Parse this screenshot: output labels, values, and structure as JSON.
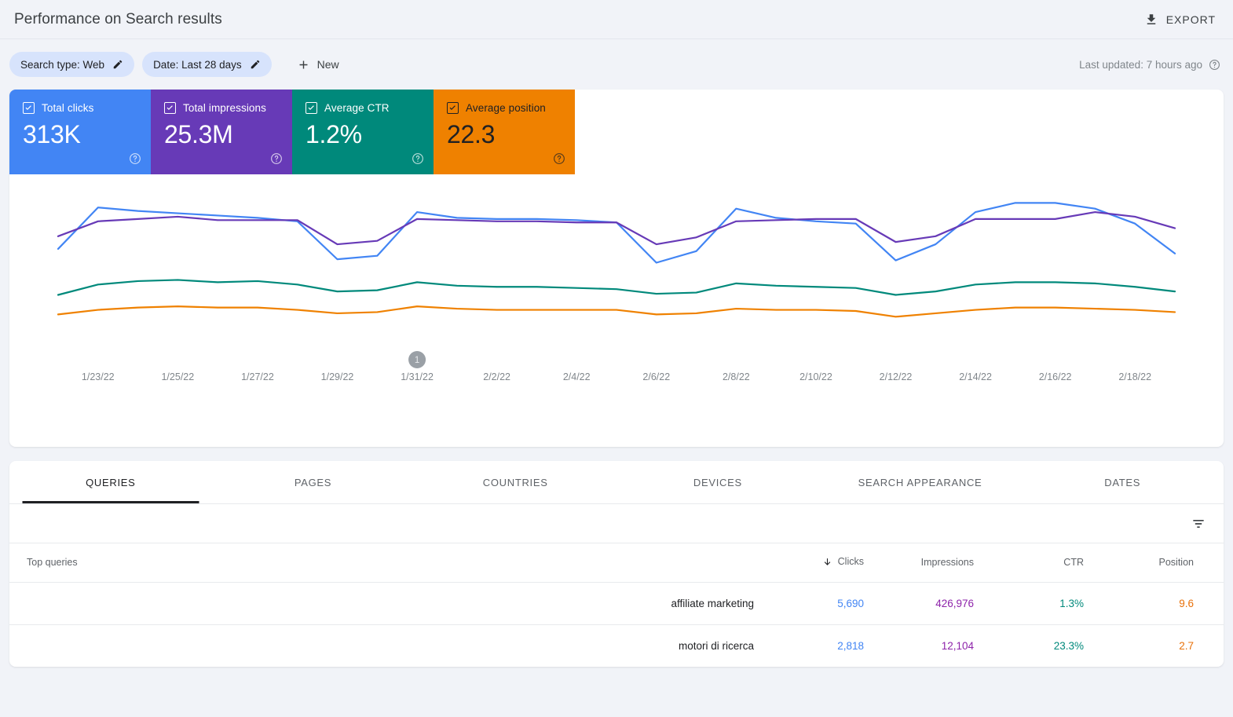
{
  "header": {
    "title": "Performance on Search results",
    "export_label": "EXPORT",
    "export_icon": "download-icon"
  },
  "filters": {
    "chips": [
      {
        "label": "Search type: Web",
        "icon": "pencil-icon"
      },
      {
        "label": "Date: Last 28 days",
        "icon": "pencil-icon"
      }
    ],
    "new_label": "New",
    "new_icon": "plus-icon",
    "last_updated": "Last updated: 7 hours ago",
    "help_icon": "help-circle-icon"
  },
  "metrics": [
    {
      "label": "Total clicks",
      "value": "313K",
      "color": "#4285f4",
      "text_color": "#ffffff",
      "checked": true
    },
    {
      "label": "Total impressions",
      "value": "25.3M",
      "color": "#673ab7",
      "text_color": "#ffffff",
      "checked": true
    },
    {
      "label": "Average CTR",
      "value": "1.2%",
      "color": "#00897b",
      "text_color": "#ffffff",
      "checked": true
    },
    {
      "label": "Average position",
      "value": "22.3",
      "color": "#ef8100",
      "text_color": "#202124",
      "checked": true
    }
  ],
  "chart_data": {
    "type": "line",
    "title": "Performance on Search results",
    "xlabel": "",
    "ylabel": "",
    "grid": false,
    "legend": "metric-cards-above",
    "x": [
      "1/22/22",
      "1/23/22",
      "1/24/22",
      "1/25/22",
      "1/26/22",
      "1/27/22",
      "1/28/22",
      "1/29/22",
      "1/30/22",
      "1/31/22",
      "2/1/22",
      "2/2/22",
      "2/3/22",
      "2/4/22",
      "2/5/22",
      "2/6/22",
      "2/7/22",
      "2/8/22",
      "2/9/22",
      "2/10/22",
      "2/11/22",
      "2/12/22",
      "2/13/22",
      "2/14/22",
      "2/15/22",
      "2/16/22",
      "2/17/22",
      "2/18/22",
      "2/19/22"
    ],
    "tick_labels": [
      "1/23/22",
      "1/25/22",
      "1/27/22",
      "1/29/22",
      "1/31/22",
      "2/2/22",
      "2/4/22",
      "2/6/22",
      "2/8/22",
      "2/10/22",
      "2/12/22",
      "2/14/22",
      "2/16/22",
      "2/18/22"
    ],
    "annotations": [
      {
        "label": "1",
        "x": "1/31/22",
        "style": "gray-circle-badge"
      }
    ],
    "series": [
      {
        "name": "Total clicks",
        "color": "#4285f4",
        "values": [
          8.2,
          11.8,
          11.5,
          11.3,
          11.1,
          10.9,
          10.6,
          7.3,
          7.6,
          11.4,
          10.9,
          10.8,
          10.8,
          10.7,
          10.5,
          7.0,
          8.0,
          11.7,
          10.9,
          10.6,
          10.4,
          7.2,
          8.6,
          11.4,
          12.2,
          12.2,
          11.7,
          10.4,
          7.8
        ]
      },
      {
        "name": "Total impressions",
        "color": "#673ab7",
        "values": [
          9.3,
          10.6,
          10.8,
          11.0,
          10.7,
          10.7,
          10.7,
          8.6,
          8.9,
          10.8,
          10.7,
          10.6,
          10.6,
          10.5,
          10.5,
          8.6,
          9.2,
          10.6,
          10.7,
          10.8,
          10.8,
          8.8,
          9.3,
          10.8,
          10.8,
          10.8,
          11.4,
          11.0,
          10.0
        ]
      },
      {
        "name": "Average CTR",
        "color": "#00897b",
        "values": [
          4.2,
          5.1,
          5.4,
          5.5,
          5.3,
          5.4,
          5.1,
          4.5,
          4.6,
          5.3,
          5.0,
          4.9,
          4.9,
          4.8,
          4.7,
          4.3,
          4.4,
          5.2,
          5.0,
          4.9,
          4.8,
          4.2,
          4.5,
          5.1,
          5.3,
          5.3,
          5.2,
          4.9,
          4.5
        ]
      },
      {
        "name": "Average position",
        "color": "#ef8100",
        "values": [
          2.5,
          2.9,
          3.1,
          3.2,
          3.1,
          3.1,
          2.9,
          2.6,
          2.7,
          3.2,
          3.0,
          2.9,
          2.9,
          2.9,
          2.9,
          2.5,
          2.6,
          3.0,
          2.9,
          2.9,
          2.8,
          2.3,
          2.6,
          2.9,
          3.1,
          3.1,
          3.0,
          2.9,
          2.7
        ]
      }
    ],
    "ylim": [
      0,
      14
    ]
  },
  "table": {
    "tabs": [
      {
        "label": "QUERIES",
        "active": true
      },
      {
        "label": "PAGES",
        "active": false
      },
      {
        "label": "COUNTRIES",
        "active": false
      },
      {
        "label": "DEVICES",
        "active": false
      },
      {
        "label": "SEARCH APPEARANCE",
        "active": false
      },
      {
        "label": "DATES",
        "active": false
      }
    ],
    "filter_icon": "funnel-icon",
    "columns": {
      "query": "Top queries",
      "clicks": "Clicks",
      "impressions": "Impressions",
      "ctr": "CTR",
      "position": "Position"
    },
    "sorted_by": "clicks",
    "sort_direction": "desc",
    "sort_icon": "arrow-down-icon",
    "rows": [
      {
        "query": "affiliate marketing",
        "clicks": "5,690",
        "impressions": "426,976",
        "ctr": "1.3%",
        "position": "9.6"
      },
      {
        "query": "motori di ricerca",
        "clicks": "2,818",
        "impressions": "12,104",
        "ctr": "23.3%",
        "position": "2.7"
      }
    ]
  }
}
